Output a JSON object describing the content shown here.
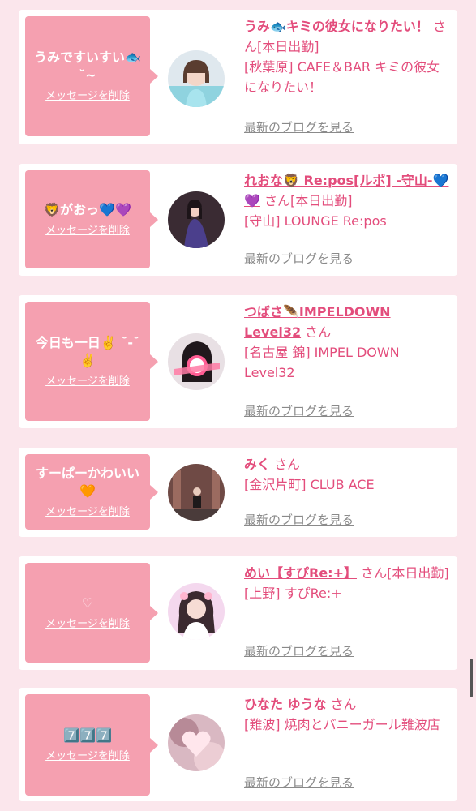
{
  "colors": {
    "accent": "#e34d7c",
    "bubble": "#f5a0b0",
    "background": "#fbe6ec",
    "blog_link": "#8a8a8a"
  },
  "delete_label": "メッセージを削除",
  "blog_label": "最新のブログを見る",
  "san": "さん",
  "today_badge": "[本日出勤]",
  "cards": [
    {
      "message": "うみですいすい🐟 ˘~",
      "name": "うみ🐟キミの彼女になりたい！",
      "shop": "[秋葉原] CAFE＆BAR キミの彼女になりたい！",
      "avatar": "avatar-girl-blue-dress"
    },
    {
      "message": "🦁がおっ💙💜",
      "name": "れおな🦁 Re:pos[ルポ] -守山-💙💜",
      "shop": "[守山] LOUNGE Re:pos",
      "avatar": "avatar-girl-purple-dress"
    },
    {
      "message": "今日も一日✌️ ˘-˘ ✌️",
      "name": "つばさ🪶IMPELDOWN Level32",
      "shop": "[名古屋 錦] IMPEL DOWN Level32",
      "avatar": "avatar-girl-sticker"
    },
    {
      "message": "すーぱーかわいい 🧡",
      "name": "みく",
      "shop": "[金沢片町] CLUB ACE",
      "avatar": "avatar-girl-street"
    },
    {
      "message": "♡",
      "name": "めい【すぴRe:+】",
      "shop": "[上野] すぴRe:+",
      "avatar": "avatar-girl-pink"
    },
    {
      "message": "7️⃣7️⃣7️⃣",
      "name": "ひなた ゆうな",
      "shop": "[難波] 焼肉とバニーガール難波店",
      "avatar": "avatar-blurred-heart"
    }
  ]
}
